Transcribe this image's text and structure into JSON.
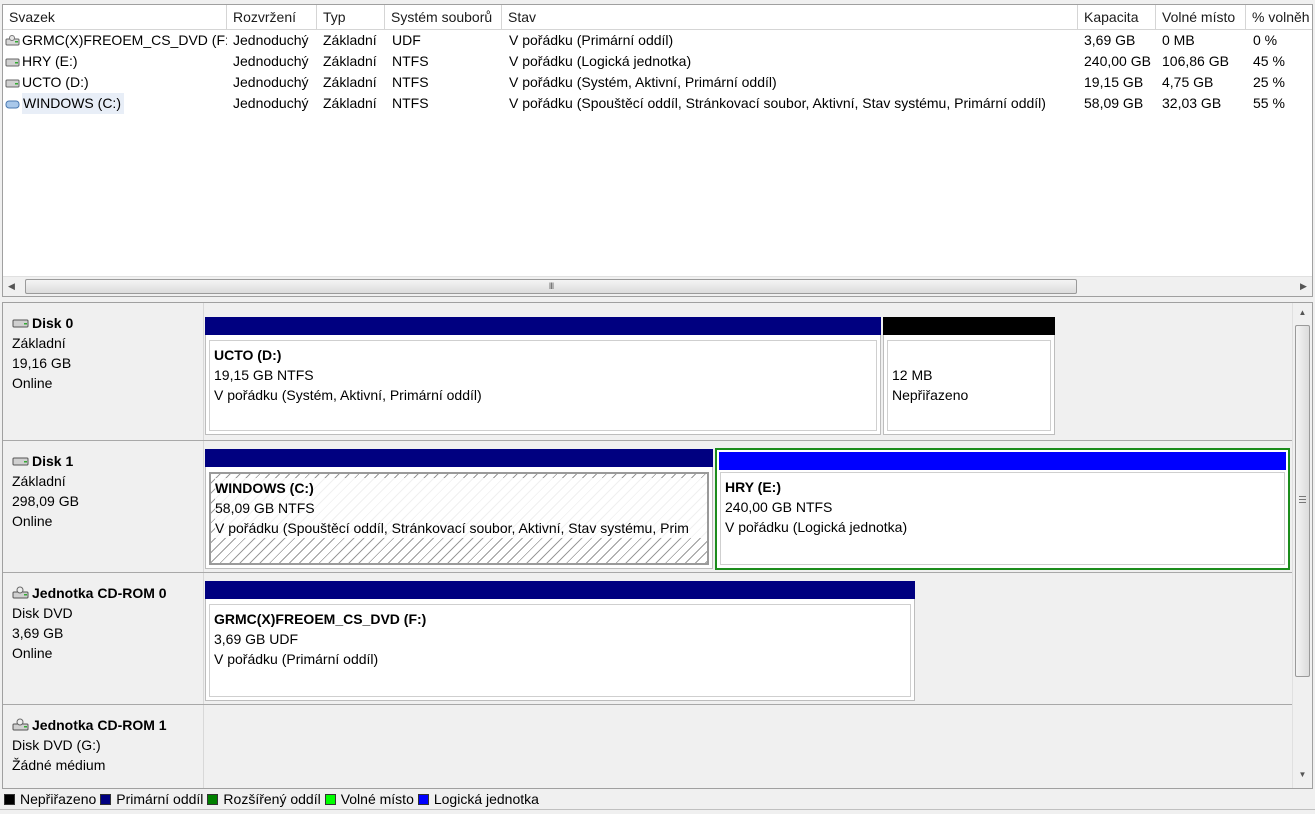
{
  "volume_list": {
    "columns": [
      "Svazek",
      "Rozvržení",
      "Typ",
      "Systém souborů",
      "Stav",
      "Kapacita",
      "Volné místo",
      "% volněh"
    ],
    "rows": [
      {
        "icon": "cd-drive-icon",
        "volume": "GRMC(X)FREOEM_CS_DVD (F:)",
        "layout": "Jednoduchý",
        "type": "Základní",
        "fs": "UDF",
        "status": "V pořádku (Primární oddíl)",
        "capacity": "3,69 GB",
        "free": "0 MB",
        "pct": "0 %"
      },
      {
        "icon": "drive-icon",
        "volume": "HRY (E:)",
        "layout": "Jednoduchý",
        "type": "Základní",
        "fs": "NTFS",
        "status": "V pořádku (Logická jednotka)",
        "capacity": "240,00 GB",
        "free": "106,86 GB",
        "pct": "45 %"
      },
      {
        "icon": "drive-icon",
        "volume": "UCTO (D:)",
        "layout": "Jednoduchý",
        "type": "Základní",
        "fs": "NTFS",
        "status": "V pořádku (Systém, Aktivní, Primární oddíl)",
        "capacity": "19,15 GB",
        "free": "4,75 GB",
        "pct": "25 %"
      },
      {
        "icon": "system-drive-icon",
        "volume": "WINDOWS (C:)",
        "layout": "Jednoduchý",
        "type": "Základní",
        "fs": "NTFS",
        "status": "V pořádku (Spouštěcí oddíl, Stránkovací soubor, Aktivní, Stav systému, Primární oddíl)",
        "capacity": "58,09 GB",
        "free": "32,03 GB",
        "pct": "55 %"
      }
    ],
    "scrollbar": {
      "left_arrow": "◀",
      "right_arrow": "▶",
      "grip": "III"
    }
  },
  "disks": [
    {
      "name": "Disk 0",
      "type": "Základní",
      "size": "19,16 GB",
      "state": "Online",
      "partitions": [
        {
          "name": "UCTO  (D:)",
          "size": "19,15 GB NTFS",
          "status": "V pořádku (Systém, Aktivní, Primární oddíl)"
        },
        {
          "name": "",
          "size": "12 MB",
          "status": "Nepřiřazeno"
        }
      ]
    },
    {
      "name": "Disk 1",
      "type": "Základní",
      "size": "298,09 GB",
      "state": "Online",
      "partitions": [
        {
          "name": "WINDOWS  (C:)",
          "size": "58,09 GB NTFS",
          "status": "V pořádku (Spouštěcí oddíl, Stránkovací soubor, Aktivní, Stav systému, Prim"
        },
        {
          "name": "HRY  (E:)",
          "size": "240,00 GB NTFS",
          "status": "V pořádku (Logická jednotka)"
        }
      ]
    },
    {
      "name": "Jednotka CD-ROM 0",
      "type": "Disk DVD",
      "size": "3,69 GB",
      "state": "Online",
      "partitions": [
        {
          "name": "GRMC(X)FREOEM_CS_DVD  (F:)",
          "size": "3,69 GB UDF",
          "status": "V pořádku (Primární oddíl)"
        }
      ]
    },
    {
      "name": "Jednotka CD-ROM 1",
      "type": "Disk DVD (G:)",
      "size": "",
      "state": "Žádné médium",
      "partitions": []
    }
  ],
  "legend": [
    {
      "label": "Nepřiřazeno",
      "color": "#000000"
    },
    {
      "label": "Primární oddíl",
      "color": "#000080"
    },
    {
      "label": "Rozšířený oddíl",
      "color": "#008000"
    },
    {
      "label": "Volné místo",
      "color": "#00ff00"
    },
    {
      "label": "Logická jednotka",
      "color": "#0000ff"
    }
  ],
  "colors": {
    "primary": "#000080",
    "unallocated": "#000000",
    "logical": "#0000ff",
    "extended": "#008000",
    "free": "#00ff00",
    "selection": "#1c8c1c"
  }
}
